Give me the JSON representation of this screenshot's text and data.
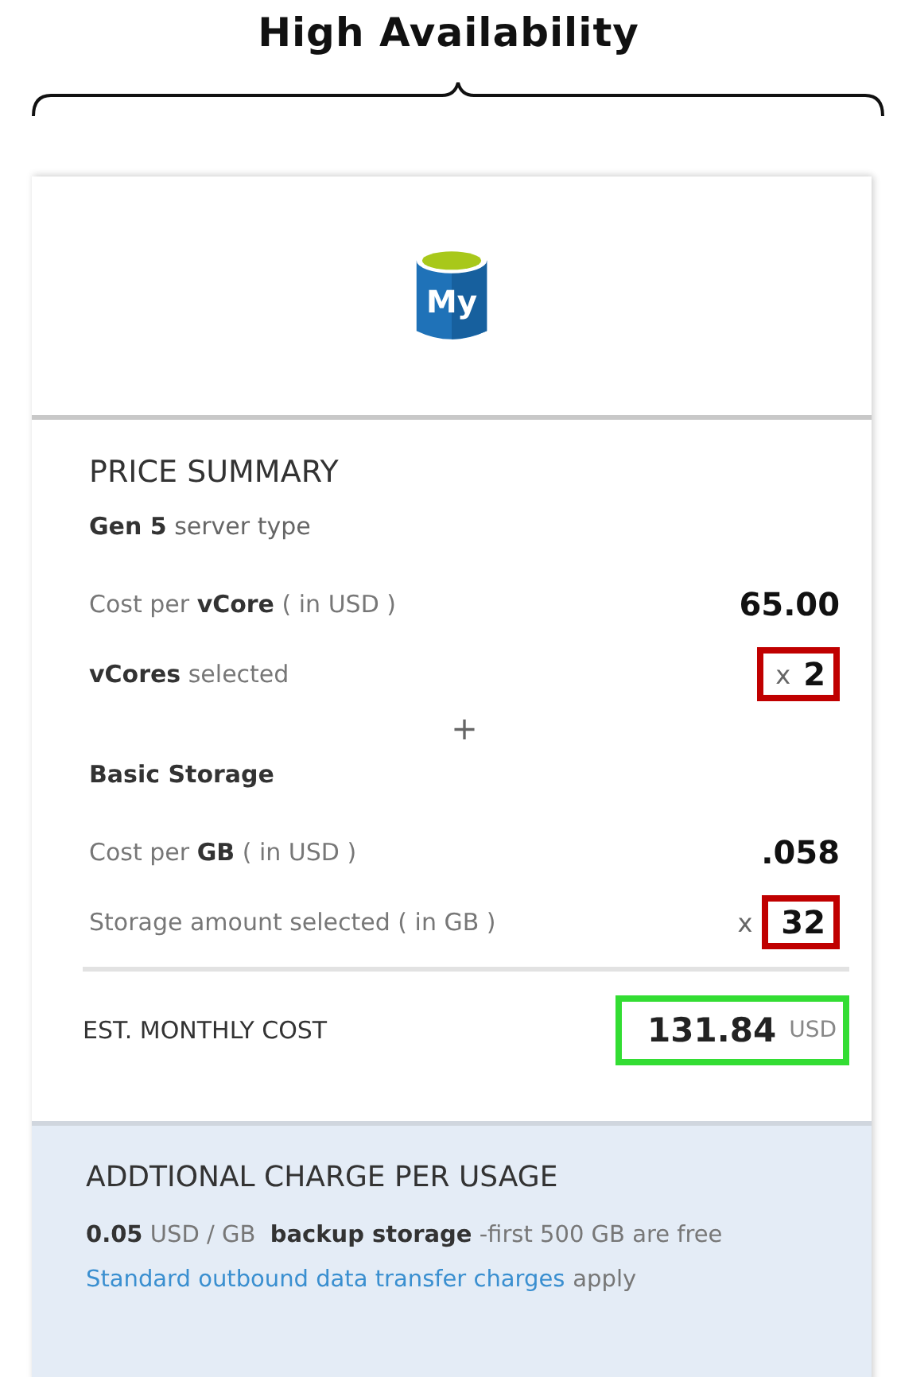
{
  "heading": {
    "title": "High Availability"
  },
  "logo": {
    "text": "My"
  },
  "price_summary": {
    "title": "PRICE SUMMARY",
    "items": [
      {
        "kind": "heading",
        "text": "**Gen 5** server type"
      },
      {
        "kind": "row",
        "label": "Cost per **vCore** ( in USD )",
        "value": "65.00"
      },
      {
        "kind": "row",
        "label": "**vCores** selected",
        "prefix": "x",
        "value": "2",
        "color": "#c00000",
        "prefix_in_highlight": true
      },
      {
        "kind": "plus",
        "text": "+"
      },
      {
        "kind": "heading",
        "text": "**Basic Storage**"
      },
      {
        "kind": "row",
        "label": "Cost per **GB** ( in USD )",
        "value": ".058"
      },
      {
        "kind": "row",
        "label": "Storage amount selected ( in GB )",
        "prefix": "x",
        "value": "32",
        "color": "#c00000",
        "prefix_in_highlight": false
      }
    ]
  },
  "total": {
    "label": "EST. MONTHLY COST",
    "value": "131.84",
    "unit": "USD",
    "color": "#33dd33"
  },
  "additional": {
    "title": "ADDTIONAL CHARGE PER USAGE",
    "line": "**0.05** USD / GB  **backup storage** -first 500 GB are free",
    "link": "Standard outbound data transfer charges",
    "link_suffix": "apply"
  }
}
